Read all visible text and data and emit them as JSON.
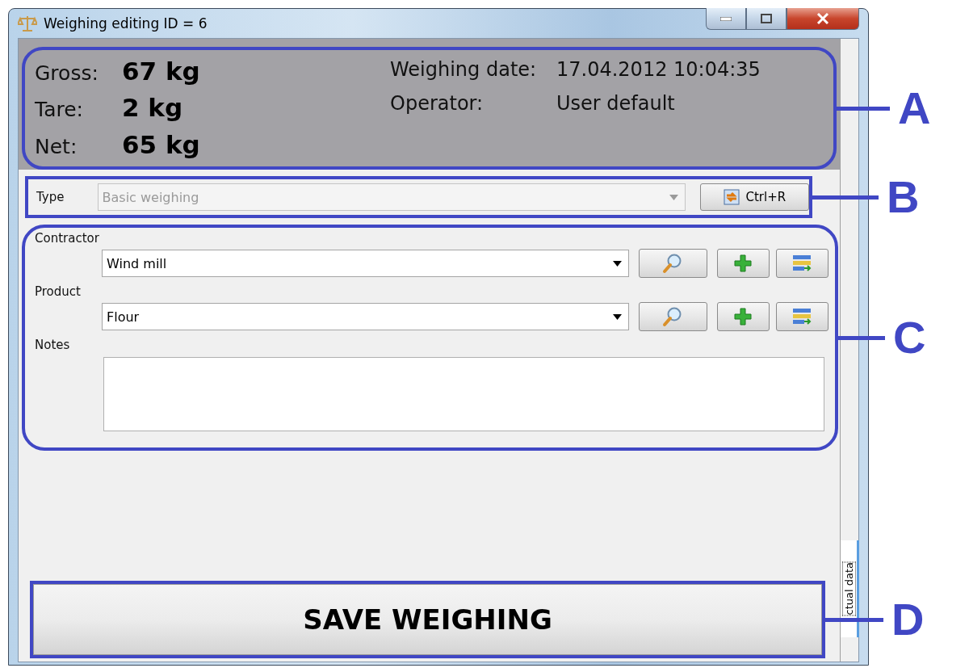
{
  "window": {
    "title": "Weighing editing ID = 6"
  },
  "weights": [
    {
      "label": "Gross:",
      "value": "67 kg"
    },
    {
      "label": "Tare:",
      "value": "2 kg"
    },
    {
      "label": "Net:",
      "value": "65 kg"
    }
  ],
  "details": [
    {
      "label": "Weighing date:",
      "value": "17.04.2012 10:04:35"
    },
    {
      "label": "Operator:",
      "value": "User default"
    }
  ],
  "type_row": {
    "label": "Type",
    "value": "Basic weighing",
    "disabled": true,
    "button": "Ctrl+R"
  },
  "fields": [
    {
      "label": "Contractor",
      "value": "Wind mill"
    },
    {
      "label": "Product",
      "value": "Flour"
    }
  ],
  "notes": {
    "label": "Notes"
  },
  "side_tab": {
    "label": "ctual data"
  },
  "save_button": "SAVE WEIGHING",
  "callouts": {
    "info": "A",
    "type": "B",
    "details": "C",
    "save": "D"
  }
}
